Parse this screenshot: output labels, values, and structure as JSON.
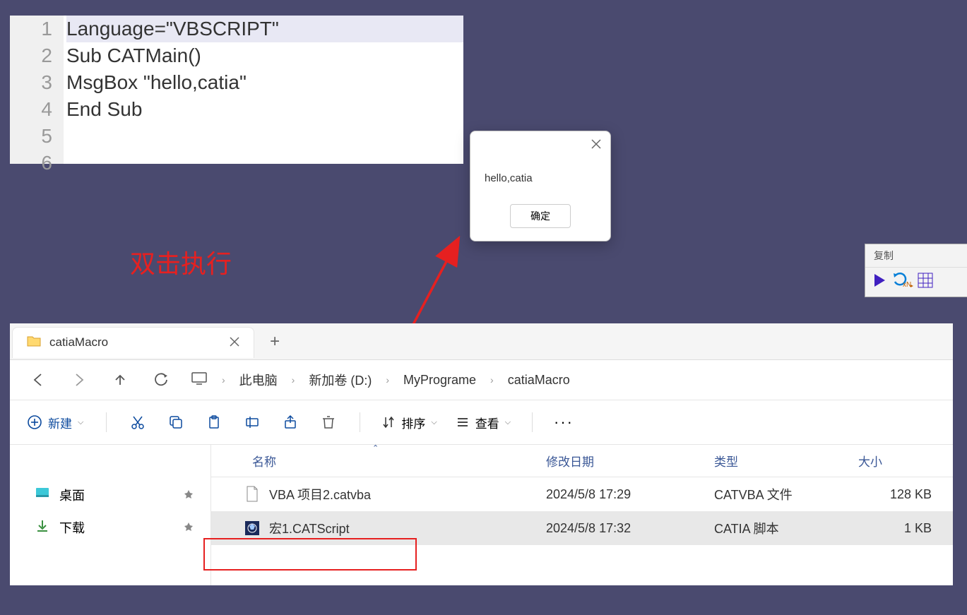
{
  "code": {
    "lines": [
      "Language=\"VBSCRIPT\"",
      "",
      "Sub CATMain()",
      "MsgBox \"hello,catia\"",
      "End Sub",
      ""
    ],
    "line_numbers": [
      "1",
      "2",
      "3",
      "4",
      "5",
      "6"
    ]
  },
  "annotation": "双击执行",
  "msgbox": {
    "message": "hello,catia",
    "ok_label": "确定"
  },
  "mini_toolbar": {
    "title": "复制"
  },
  "explorer": {
    "tab": {
      "title": "catiaMacro"
    },
    "breadcrumb": {
      "items": [
        "此电脑",
        "新加卷 (D:)",
        "MyPrograme",
        "catiaMacro"
      ]
    },
    "toolbar": {
      "new_label": "新建",
      "sort_label": "排序",
      "view_label": "查看"
    },
    "sidebar": {
      "desktop": "桌面",
      "downloads": "下载"
    },
    "columns": {
      "name": "名称",
      "date": "修改日期",
      "type": "类型",
      "size": "大小"
    },
    "files": [
      {
        "name": "VBA 项目2.catvba",
        "date": "2024/5/8 17:29",
        "type": "CATVBA 文件",
        "size": "128 KB",
        "selected": false,
        "icon": "doc"
      },
      {
        "name": "宏1.CATScript",
        "date": "2024/5/8 17:32",
        "type": "CATIA 脚本",
        "size": "1 KB",
        "selected": true,
        "icon": "catia"
      }
    ]
  }
}
